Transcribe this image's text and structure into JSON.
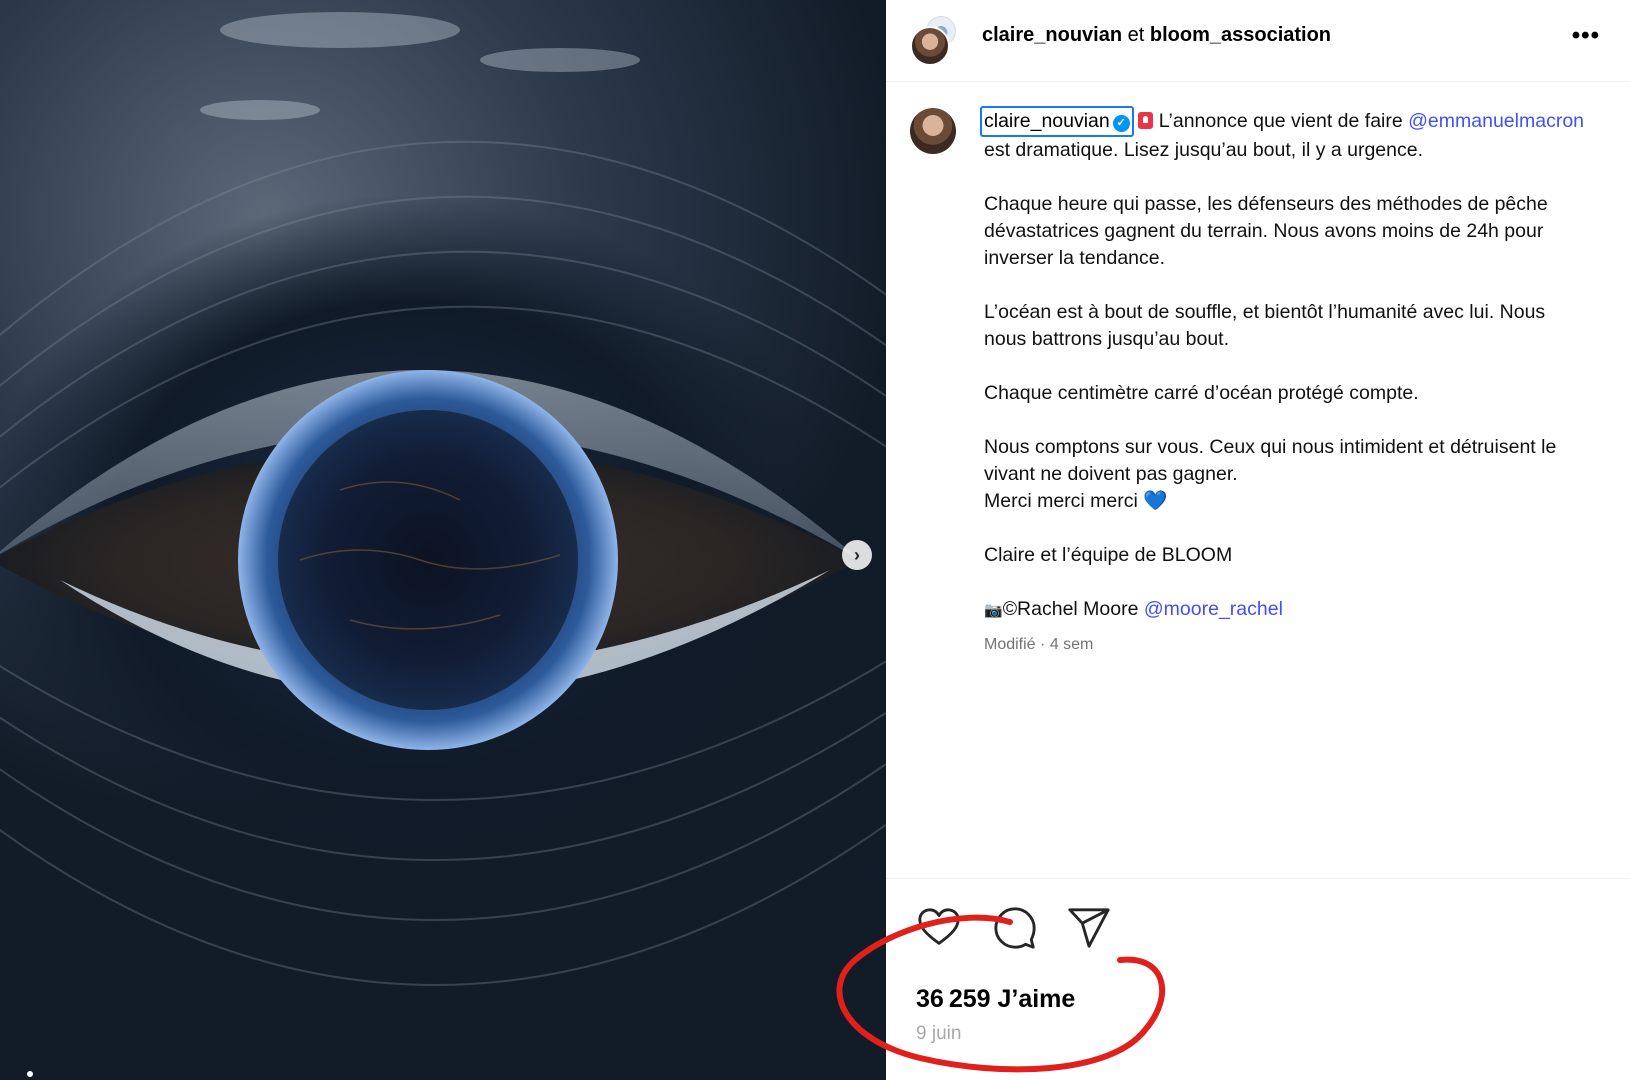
{
  "post": {
    "header": {
      "author": "claire_nouvian",
      "joiner": "et",
      "coauthor": "bloom_association",
      "more_label": "•••"
    },
    "caption": {
      "author": "claire_nouvian",
      "verified_mark": "✓",
      "intro": "L’annonce que vient de faire",
      "mention_macron": "@emmanuelmacron",
      "intro_rest": "est dramatique. Lisez jusqu’au bout, il y a urgence.",
      "para2": "Chaque heure qui passe, les défenseurs des méthodes de pêche dévastatrices gagnent du terrain. Nous avons moins de 24h pour inverser la tendance.",
      "para3": "L’océan est à bout de souffle, et bientôt l’humanité avec lui. Nous nous battrons jusqu’au bout.",
      "para4": "Chaque centimètre carré d’océan protégé compte.",
      "para5_line1": "Nous comptons sur vous. Ceux qui nous intimident et détruisent le vivant ne doivent pas gagner.",
      "para5_line2": "Merci merci merci",
      "heart_emoji": "💙",
      "signature": "Claire et l’équipe de BLOOM",
      "camera_emoji": "📷",
      "credit": "©Rachel Moore",
      "mention_photographer": "@moore_rachel",
      "meta_edited": "Modifié",
      "meta_separator": "·",
      "meta_time": "4 sem"
    },
    "actions": {
      "like_icon": "heart-icon",
      "comment_icon": "comment-icon",
      "share_icon": "send-icon"
    },
    "likes": "36 259 J’aime",
    "date": "9 juin"
  },
  "colors": {
    "mention": "#4150f7",
    "verified": "#0095f6",
    "annotation": "#e0201b",
    "secondary_text": "#737373"
  },
  "carousel": {
    "next_label": "›"
  }
}
